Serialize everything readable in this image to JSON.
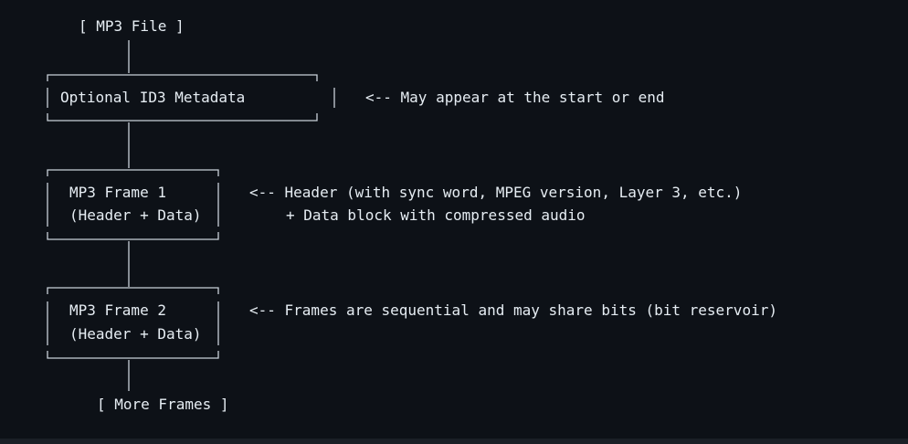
{
  "diagram": {
    "start_label": "[ MP3 File ]",
    "id3_box_label": "Optional ID3 Metadata",
    "id3_note": "<-- May appear at the start or end",
    "frame1": {
      "line1": "MP3 Frame 1",
      "line2": "(Header + Data)",
      "note_line1": "<-- Header (with sync word, MPEG version, Layer 3, etc.)",
      "note_line2": "+ Data block with compressed audio"
    },
    "frame2": {
      "line1": "MP3 Frame 2",
      "line2": "(Header + Data)",
      "note_line1": "<-- Frames are sequential and may share bits (bit reservoir)"
    },
    "end_label": "[ More Frames ]"
  },
  "colors": {
    "background": "#0d1117",
    "text": "#e6edf3",
    "lines": "#c9d1d9"
  }
}
